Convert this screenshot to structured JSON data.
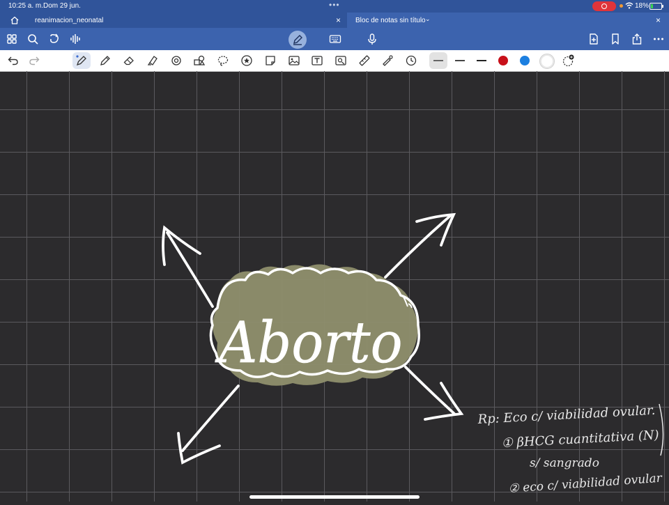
{
  "status_bar": {
    "time": "10:25 a. m.",
    "date": "Dom 29 jun.",
    "battery": "18%",
    "icons": [
      "multitasking-dots-icon",
      "screen-record-icon",
      "wifi-icon",
      "battery-icon"
    ]
  },
  "tabs": [
    {
      "title": "reanimacion_neonatal",
      "active": false
    },
    {
      "title": "Bloc de notas sin título",
      "active": true
    }
  ],
  "app_bar": {
    "left_icons": [
      "grid-icon",
      "search-icon",
      "lasso-share-icon",
      "audio-wave-icon"
    ],
    "center_icons": [
      "pencil-mode-icon",
      "keyboard-icon",
      "microphone-icon"
    ],
    "right_icons": [
      "add-page-icon",
      "bookmark-icon",
      "share-icon",
      "more-icon"
    ]
  },
  "toolbar": {
    "tools": [
      "undo-icon",
      "redo-icon",
      "fountain-pen-icon",
      "pencil-icon",
      "eraser-icon",
      "highlighter-icon",
      "shape-icon",
      "shapes-icon",
      "lasso-icon",
      "sticker-icon",
      "note-icon",
      "image-icon",
      "text-icon",
      "camera-icon",
      "ruler-icon",
      "laser-pointer-icon",
      "history-icon"
    ],
    "colors": {
      "black": "#1a1a1a",
      "red": "#c8101a",
      "blue": "#1c7fe0",
      "white": "#ffffff"
    }
  },
  "canvas": {
    "background": "#2c2b2d",
    "grid_color": "#5b5a5e",
    "cloud_fill": "#8f8f6d",
    "center_word": "Aborto",
    "notes": {
      "line1": "Rp: Eco c/ viabilidad ovular.",
      "line2": "① βHCG cuantitativa (N)",
      "line3": "s/ sangrado",
      "line4": "② eco c/ viabilidad ovular"
    }
  }
}
